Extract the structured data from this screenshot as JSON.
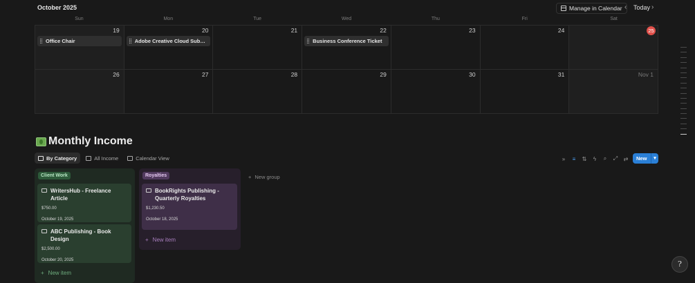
{
  "calendar": {
    "month_title": "October 2025",
    "manage_label": "Manage in Calendar",
    "today_label": "Today",
    "prev_icon": "‹",
    "next_icon": "›",
    "weekdays": [
      "Sun",
      "Mon",
      "Tue",
      "Wed",
      "Thu",
      "Fri",
      "Sat"
    ],
    "weeks": [
      [
        {
          "day": "19",
          "event": "Office Chair"
        },
        {
          "day": "20",
          "event": "Adobe Creative Cloud Subscri..."
        },
        {
          "day": "21"
        },
        {
          "day": "22",
          "event": "Business Conference Ticket"
        },
        {
          "day": "23"
        },
        {
          "day": "24"
        },
        {
          "day": "25"
        }
      ],
      [
        {
          "day": "26"
        },
        {
          "day": "27"
        },
        {
          "day": "28"
        },
        {
          "day": "29"
        },
        {
          "day": "30"
        },
        {
          "day": "31"
        },
        {
          "day": "Nov 1"
        }
      ]
    ]
  },
  "income": {
    "title": "Monthly Income",
    "views": [
      "By Category",
      "All Income",
      "Calendar View"
    ],
    "toolbar_icons": [
      "»",
      "≡",
      "⇅",
      "ϟ",
      "⌕",
      "⤢",
      "⇄"
    ],
    "new_label": "New",
    "new_group_label": "New group",
    "new_item_label": "New item",
    "groups": [
      {
        "tag": "Client Work",
        "cards": [
          {
            "title": "WritersHub - Freelance Article",
            "amount": "$750.00",
            "date": "October 19, 2025"
          },
          {
            "title": "ABC Publishing - Book Design",
            "amount": "$2,500.00",
            "date": "October 20, 2025"
          }
        ]
      },
      {
        "tag": "Royalties",
        "cards": [
          {
            "title": "BookRights Publishing - Quarterly Royalties",
            "amount": "$1,230.50",
            "date": "October 18, 2025"
          }
        ]
      }
    ]
  },
  "colors": {
    "today_badge": "#e0504a",
    "new_button": "#2a7fd6",
    "client_group": "#2d5a3a",
    "royalty_group": "#513a5e"
  }
}
